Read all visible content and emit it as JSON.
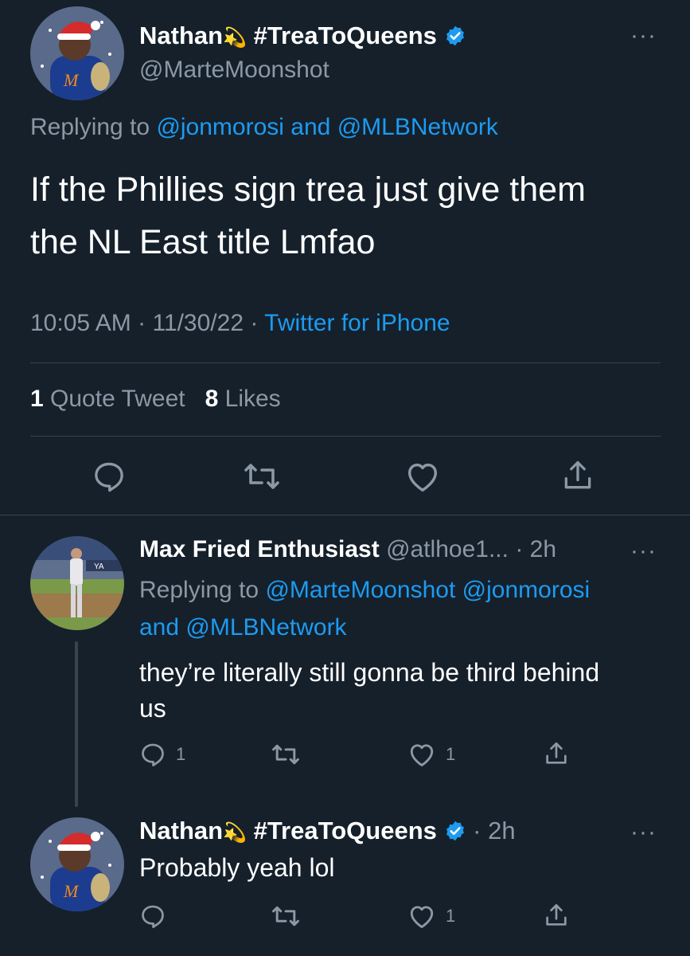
{
  "main_tweet": {
    "display_name": "Nathan",
    "name_emoji": "💫",
    "hashtag": "#TreaToQueens",
    "handle": "@MarteMoonshot",
    "replying_prefix": "Replying to ",
    "reply_to_1": "@jonmorosi",
    "reply_and": " and ",
    "reply_to_2": "@MLBNetwork",
    "text_line1": "If the Phillies sign trea just give them",
    "text_line2": "the NL East title Lmfao",
    "time": "10:05 AM",
    "date": "11/30/22",
    "sep": "·",
    "source": "Twitter for iPhone",
    "quote_count": "1",
    "quote_label": "Quote Tweet",
    "like_count": "8",
    "like_label": "Likes"
  },
  "reply_1": {
    "display_name": "Max Fried Enthusiast",
    "handle": "@atlhoe1...",
    "time": "· 2h",
    "replying_prefix": "Replying to ",
    "reply_to_1": "@MarteMoonshot",
    "reply_to_2": "@jonmorosi",
    "reply_and": "and ",
    "reply_to_3": "@MLBNetwork",
    "text_line1": "they’re literally still gonna be third behind",
    "text_line2": "us",
    "reply_count": "1",
    "like_count": "1"
  },
  "reply_2": {
    "display_name": "Nathan",
    "name_emoji": "💫",
    "hashtag": "#TreaToQueens",
    "time": "· 2h",
    "text": "Probably yeah lol",
    "like_count": "1"
  },
  "more_glyph": "···",
  "colors": {
    "background": "#15202b",
    "muted": "#8b98a5",
    "link": "#1d9bf0",
    "divider": "#38444d"
  }
}
